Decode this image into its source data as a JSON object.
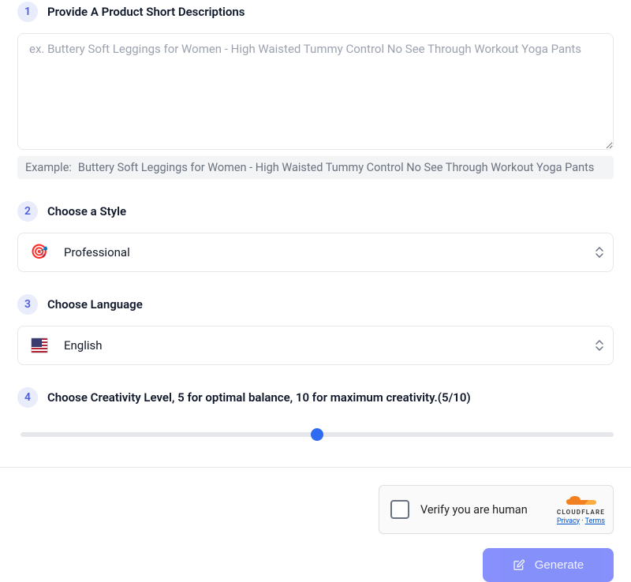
{
  "steps": {
    "s1": {
      "num": "1",
      "title": "Provide A Product Short Descriptions"
    },
    "s2": {
      "num": "2",
      "title": "Choose a Style"
    },
    "s3": {
      "num": "3",
      "title": "Choose Language"
    },
    "s4": {
      "num": "4",
      "title": "Choose Creativity Level, 5 for optimal balance, 10 for maximum creativity.",
      "suffix": "(5/10)"
    }
  },
  "input": {
    "placeholder": "ex. Buttery Soft Leggings for Women - High Waisted Tummy Control No See Through Workout Yoga Pants",
    "value": ""
  },
  "example": {
    "label": "Example:",
    "text": "Buttery Soft Leggings for Women - High Waisted Tummy Control No See Through Workout Yoga Pants"
  },
  "style": {
    "icon": "🎯",
    "selected": "Professional"
  },
  "language": {
    "selected": "English"
  },
  "creativity": {
    "min": 0,
    "max": 10,
    "value": 5
  },
  "turnstile": {
    "label": "Verify you are human",
    "brand": "CLOUDFLARE",
    "privacy": "Privacy",
    "sep": "·",
    "terms": "Terms"
  },
  "generate_label": "Generate"
}
